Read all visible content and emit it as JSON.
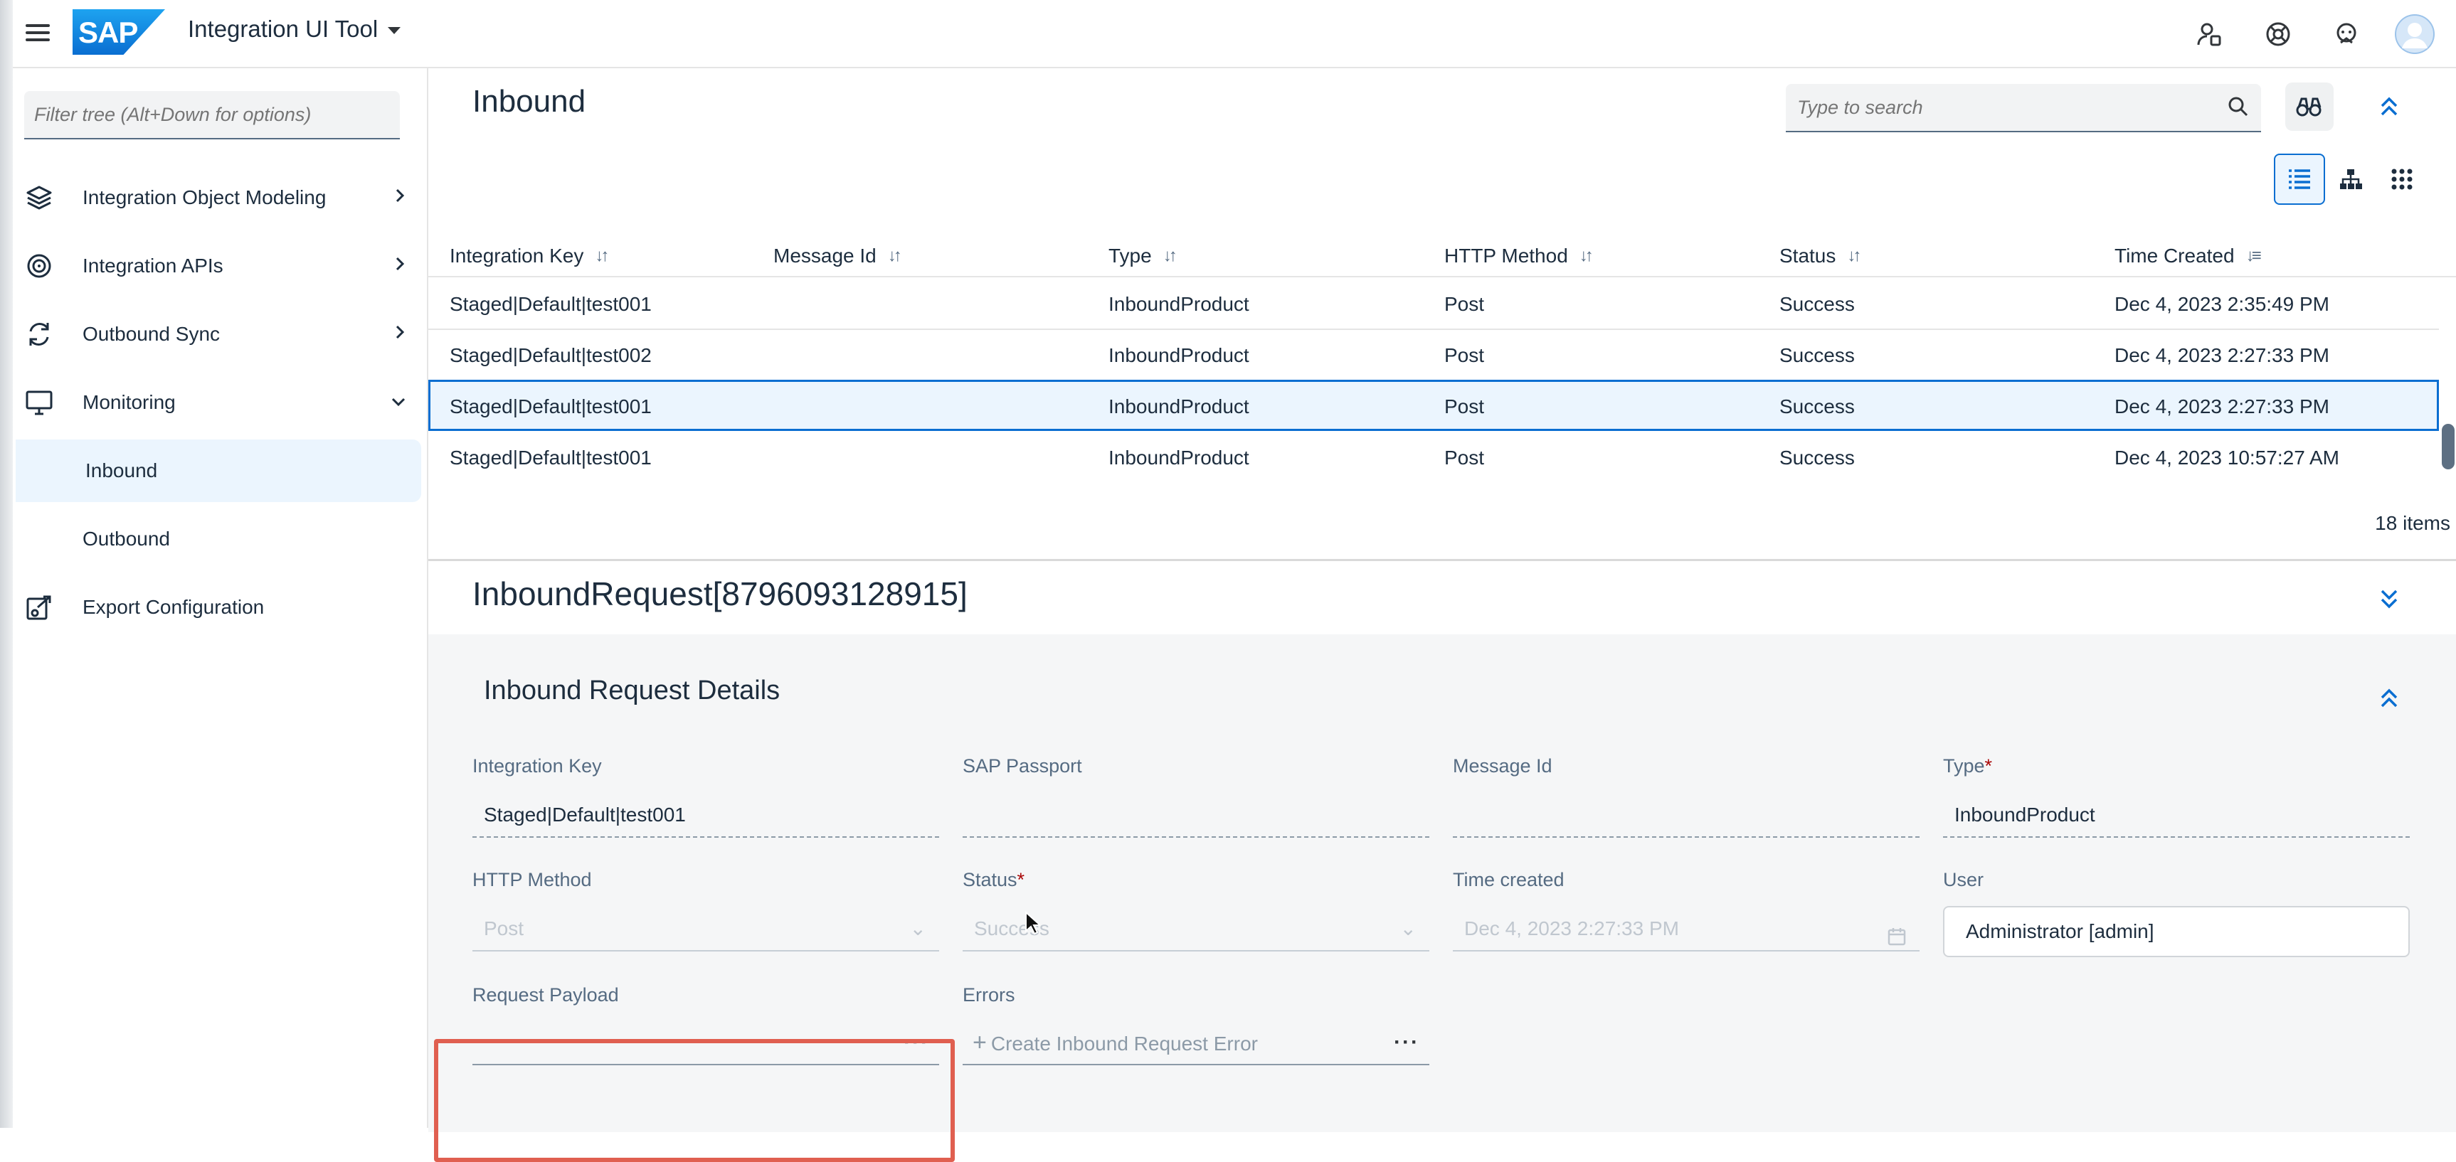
{
  "shell": {
    "app_title": "Integration UI Tool",
    "logo_text": "SAP",
    "icons": [
      "user-settings-icon",
      "help-icon",
      "collaboration-icon",
      "avatar"
    ]
  },
  "sidebar": {
    "filter_placeholder": "Filter tree (Alt+Down for options)",
    "items": [
      {
        "label": "Integration Object Modeling",
        "icon": "layers-icon",
        "expandable": true,
        "expanded": false
      },
      {
        "label": "Integration APIs",
        "icon": "api-icon",
        "expandable": true,
        "expanded": false
      },
      {
        "label": "Outbound Sync",
        "icon": "sync-icon",
        "expandable": true,
        "expanded": false
      },
      {
        "label": "Monitoring",
        "icon": "monitor-icon",
        "expandable": true,
        "expanded": true
      },
      {
        "label": "Inbound",
        "sub": true,
        "selected": true
      },
      {
        "label": "Outbound",
        "sub": true,
        "selected": false
      },
      {
        "label": "Export Configuration",
        "icon": "export-icon",
        "expandable": false
      }
    ]
  },
  "main": {
    "title": "Inbound",
    "search_placeholder": "Type to search",
    "view_modes": [
      "list-view-icon",
      "hierarchy-view-icon",
      "grid-view-icon"
    ],
    "active_view": "list-view-icon",
    "table": {
      "columns": [
        "Integration Key",
        "Message Id",
        "Type",
        "HTTP Method",
        "Status",
        "Time Created"
      ],
      "rows": [
        {
          "integration_key": "Staged|Default|test001",
          "message_id": "",
          "type": "InboundProduct",
          "http_method": "Post",
          "status": "Success",
          "time_created": "Dec 4, 2023 2:35:49 PM",
          "selected": false
        },
        {
          "integration_key": "Staged|Default|test002",
          "message_id": "",
          "type": "InboundProduct",
          "http_method": "Post",
          "status": "Success",
          "time_created": "Dec 4, 2023 2:27:33 PM",
          "selected": false
        },
        {
          "integration_key": "Staged|Default|test001",
          "message_id": "",
          "type": "InboundProduct",
          "http_method": "Post",
          "status": "Success",
          "time_created": "Dec 4, 2023 2:27:33 PM",
          "selected": true
        },
        {
          "integration_key": "Staged|Default|test001",
          "message_id": "",
          "type": "InboundProduct",
          "http_method": "Post",
          "status": "Success",
          "time_created": "Dec 4, 2023 10:57:27 AM",
          "selected": false
        }
      ],
      "item_count": "18 items"
    }
  },
  "detail": {
    "object_title": "InboundRequest[8796093128915]",
    "section_title": "Inbound Request Details",
    "fields": {
      "integration_key": {
        "label": "Integration Key",
        "value": "Staged|Default|test001"
      },
      "sap_passport": {
        "label": "SAP Passport",
        "value": ""
      },
      "message_id": {
        "label": "Message Id",
        "value": ""
      },
      "type": {
        "label": "Type",
        "required_mark": "*",
        "value": "InboundProduct"
      },
      "http_method": {
        "label": "HTTP Method",
        "value": "Post"
      },
      "status": {
        "label": "Status",
        "required_mark": "*",
        "value": "Success"
      },
      "time_created": {
        "label": "Time created",
        "value": "Dec 4, 2023 2:27:33 PM"
      },
      "user": {
        "label": "User",
        "value": "Administrator [admin]"
      },
      "request_payload": {
        "label": "Request Payload",
        "value": ""
      },
      "errors": {
        "label": "Errors",
        "placeholder": "Create Inbound Request Error"
      }
    }
  },
  "colors": {
    "accent": "#0a6ed1",
    "highlight_box": "#e05f50",
    "selected_row": "#ebf5fe"
  }
}
